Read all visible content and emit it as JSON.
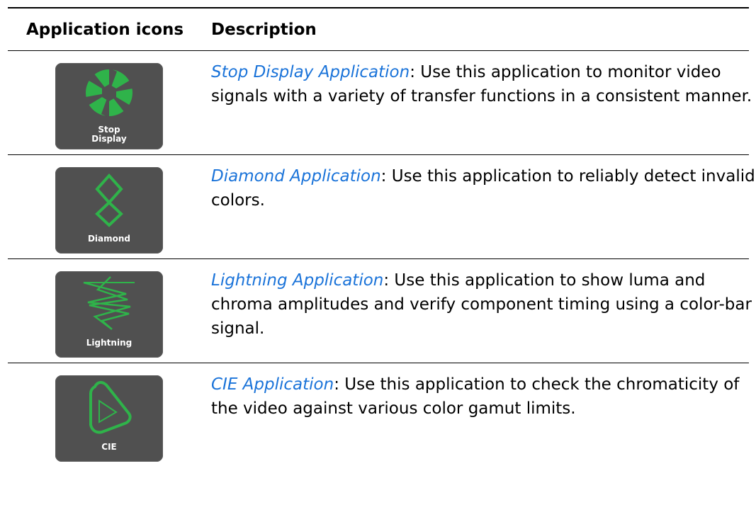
{
  "table": {
    "headers": {
      "icons": "Application icons",
      "description": "Description"
    },
    "rows": [
      {
        "icon_name": "stop-display-icon",
        "icon_caption": [
          "Stop",
          "Display"
        ],
        "link": "Stop Display Application",
        "text": ": Use this application to monitor video signals with a variety of transfer functions in a consistent manner."
      },
      {
        "icon_name": "diamond-icon",
        "icon_caption": [
          "Diamond"
        ],
        "link": "Diamond Application",
        "text": ": Use this application to reliably detect invalid colors."
      },
      {
        "icon_name": "lightning-icon",
        "icon_caption": [
          "Lightning"
        ],
        "link": "Lightning Application",
        "text": ": Use this application to show luma and chroma amplitudes and verify component timing using a color-bar signal."
      },
      {
        "icon_name": "cie-icon",
        "icon_caption": [
          "CIE"
        ],
        "link": "CIE Application",
        "text": ": Use this application to check the chromaticity of the video against various color gamut limits."
      }
    ]
  },
  "colors": {
    "link": "#1a73d9",
    "icon_tile": "#505050",
    "icon_green": "#2fb34a",
    "caption": "#ffffff"
  }
}
